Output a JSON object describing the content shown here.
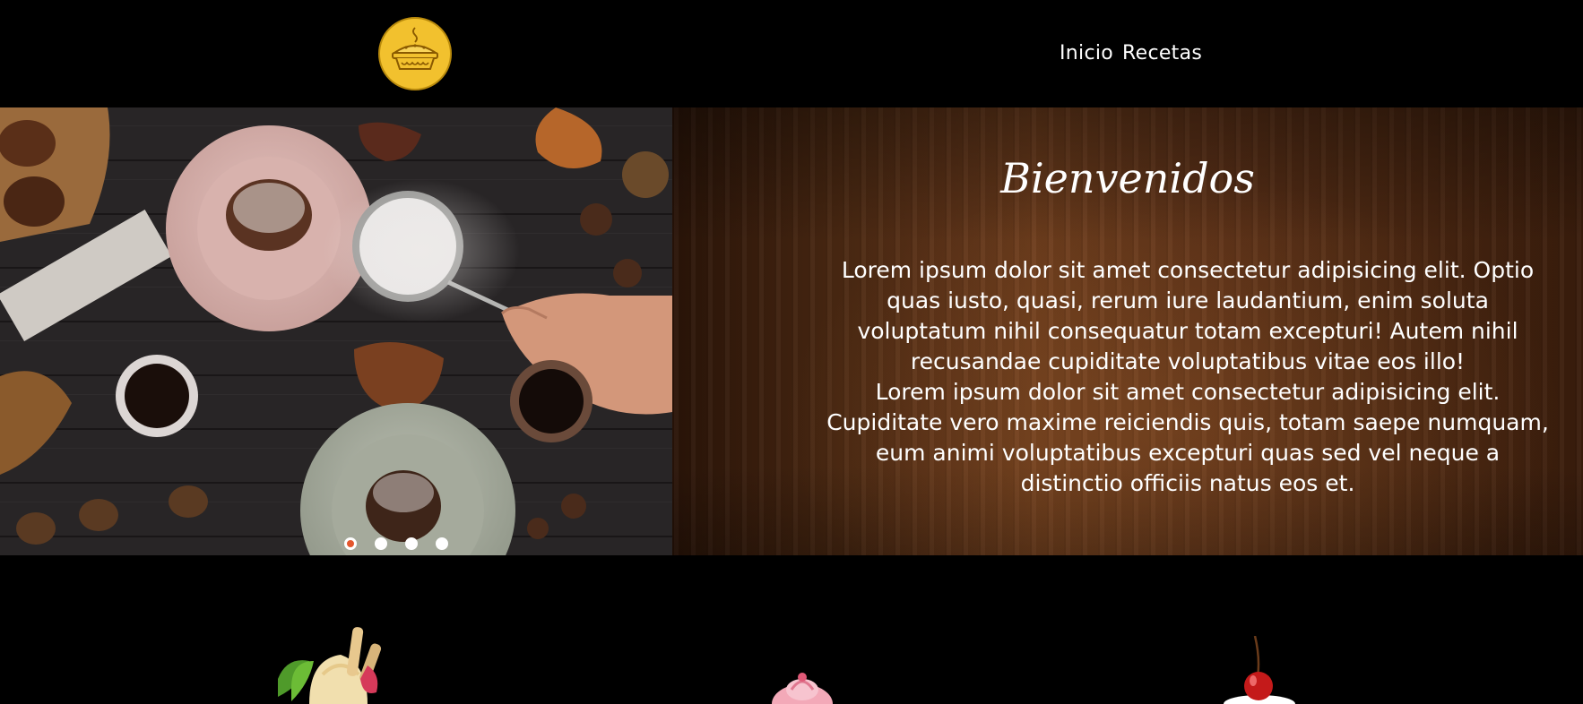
{
  "header": {
    "logo_icon": "pie-icon",
    "nav": [
      {
        "label": "Inicio"
      },
      {
        "label": "Recetas"
      }
    ]
  },
  "carousel": {
    "image": "pastry-table-photo",
    "active_slide": 1,
    "slide_count": 4
  },
  "welcome": {
    "title": "Bienvenidos",
    "paragraph_1": "Lorem ipsum dolor sit amet consectetur adipisicing elit. Optio quas iusto, quasi, rerum iure laudantium, enim soluta voluptatum nihil consequatur totam excepturi! Autem nihil recusandae cupiditate voluptatibus vitae eos illo!",
    "paragraph_2": "Lorem ipsum dolor sit amet consectetur adipisicing elit. Cupiditate vero maxime reiciendis quis, totam saepe numquam, eum animi voluptatibus excepturi quas sed vel neque a distinctio officiis natus eos et."
  },
  "desserts": [
    {
      "icon": "ice-cream-sundae-icon"
    },
    {
      "icon": "cupcake-icon"
    },
    {
      "icon": "cherry-cake-icon"
    }
  ],
  "colors": {
    "logo": "#f2c12e",
    "active_dot": "#e4572e",
    "wood": "#5a3017"
  }
}
